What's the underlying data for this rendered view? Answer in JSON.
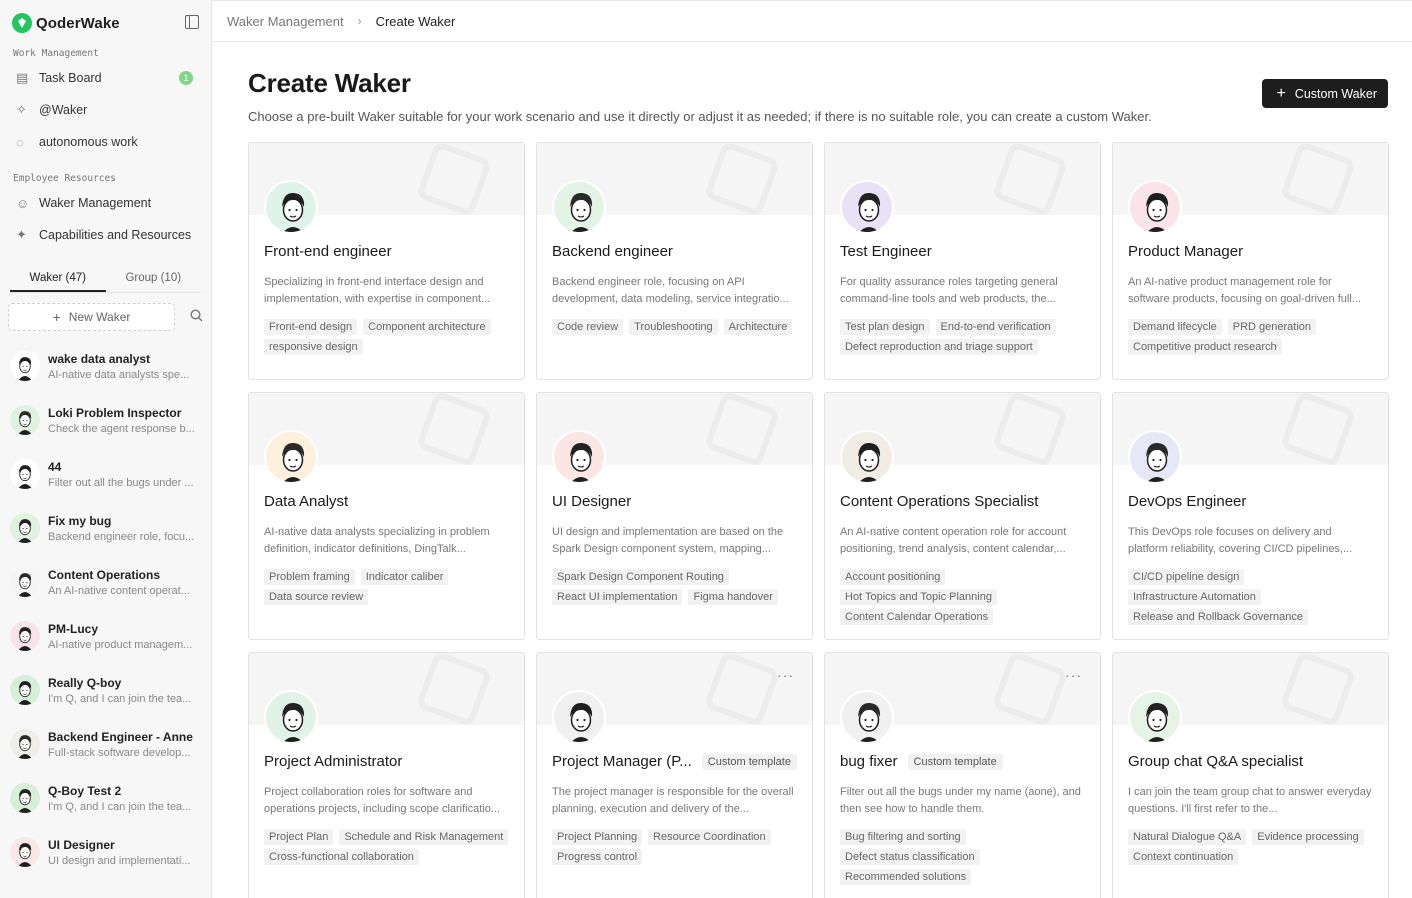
{
  "brand": {
    "name": "QoderWake"
  },
  "sidebar": {
    "work_label": "Work Management",
    "work_items": [
      {
        "label": "Task Board",
        "icon": "board-icon",
        "badge": "1"
      },
      {
        "label": "@Waker",
        "icon": "waker-icon"
      },
      {
        "label": "autonomous work",
        "icon": "bulb-icon"
      }
    ],
    "resources_label": "Employee Resources",
    "resource_items": [
      {
        "label": "Waker Management",
        "icon": "user-gear-icon"
      },
      {
        "label": "Capabilities and Resources",
        "icon": "sparkle-icon"
      }
    ],
    "tabs": [
      "Waker  (47)",
      "Group  (10)"
    ],
    "new_waker": "New Waker",
    "wakers": [
      {
        "name": "wake data analyst",
        "desc": "AI-native data analysts spe..."
      },
      {
        "name": "Loki Problem Inspector",
        "desc": "Check the agent response b..."
      },
      {
        "name": "44",
        "desc": "Filter out all the bugs under ..."
      },
      {
        "name": "Fix my bug",
        "desc": "Backend engineer role, focu..."
      },
      {
        "name": "Content Operations",
        "desc": "An AI-native content operat..."
      },
      {
        "name": "PM-Lucy",
        "desc": "AI-native product managem..."
      },
      {
        "name": "Really Q-boy",
        "desc": "I'm Q, and I can join the tea..."
      },
      {
        "name": "Backend Engineer - Anne",
        "desc": "Full-stack software develop..."
      },
      {
        "name": "Q-Boy Test 2",
        "desc": "I'm Q, and I can join the tea..."
      },
      {
        "name": "UI Designer",
        "desc": "UI design and implementati..."
      }
    ]
  },
  "breadcrumb": {
    "parent": "Waker Management",
    "current": "Create Waker"
  },
  "header": {
    "title": "Create Waker",
    "subtitle": "Choose a pre-built Waker suitable for your work scenario and use it directly or adjust it as needed; if there is no suitable role, you can create a custom Waker.",
    "custom_button": "Custom Waker"
  },
  "custom_label": "Custom template",
  "cards": [
    {
      "name": "Front-end engineer",
      "desc": "Specializing in front-end interface design and implementation, with expertise in component...",
      "tags": [
        "Front-end design",
        "Component architecture",
        "responsive design"
      ]
    },
    {
      "name": "Backend engineer",
      "desc": "Backend engineer role, focusing on API development, data modeling, service integratio...",
      "tags": [
        "Code review",
        "Troubleshooting",
        "Architecture"
      ]
    },
    {
      "name": "Test Engineer",
      "desc": "For quality assurance roles targeting general command-line tools and web products, the...",
      "tags": [
        "Test plan design",
        "End-to-end verification",
        "Defect reproduction and triage support"
      ]
    },
    {
      "name": "Product Manager",
      "desc": "An AI-native product management role for software products, focusing on goal-driven full...",
      "tags": [
        "Demand lifecycle",
        "PRD generation",
        "Competitive product research"
      ]
    },
    {
      "name": "Data Analyst",
      "desc": "AI-native data analysts specializing in problem definition, indicator definitions, DingTalk...",
      "tags": [
        "Problem framing",
        "Indicator caliber",
        "Data source review"
      ]
    },
    {
      "name": "UI Designer",
      "desc": "UI design and implementation are based on the Spark Design component system, mapping...",
      "tags": [
        "Spark Design Component Routing",
        "React UI implementation",
        "Figma handover"
      ]
    },
    {
      "name": "Content Operations Specialist",
      "desc": "An AI-native content operation role for account positioning, trend analysis, content calendar,...",
      "tags": [
        "Account positioning",
        "Hot Topics and Topic Planning",
        "Content Calendar Operations"
      ]
    },
    {
      "name": "DevOps Engineer",
      "desc": "This DevOps role focuses on delivery and platform reliability, covering CI/CD pipelines,...",
      "tags": [
        "CI/CD pipeline design",
        "Infrastructure Automation",
        "Release and Rollback Governance"
      ]
    },
    {
      "name": "Project Administrator",
      "desc": "Project collaboration roles for software and operations projects, including scope clarificatio...",
      "tags": [
        "Project Plan",
        "Schedule and Risk Management",
        "Cross-functional collaboration"
      ]
    },
    {
      "name": "Project Manager (P...",
      "desc": "The project manager is responsible for the overall planning, execution and delivery of the...",
      "tags": [
        "Project Planning",
        "Resource Coordination",
        "Progress control"
      ],
      "custom": true
    },
    {
      "name": "bug fixer",
      "desc": "Filter out all the bugs under my name (aone), and then see how to handle them.",
      "tags": [
        "Bug filtering and sorting",
        "Defect status classification",
        "Recommended solutions"
      ],
      "custom": true
    },
    {
      "name": "Group chat Q&A specialist",
      "desc": "I can join the team group chat to answer everyday questions. I'll first refer to the...",
      "tags": [
        "Natural Dialogue Q&A",
        "Evidence processing",
        "Context continuation"
      ]
    }
  ],
  "colors": {
    "accent": "#22c55e",
    "button_dark": "#1d1d1d"
  }
}
